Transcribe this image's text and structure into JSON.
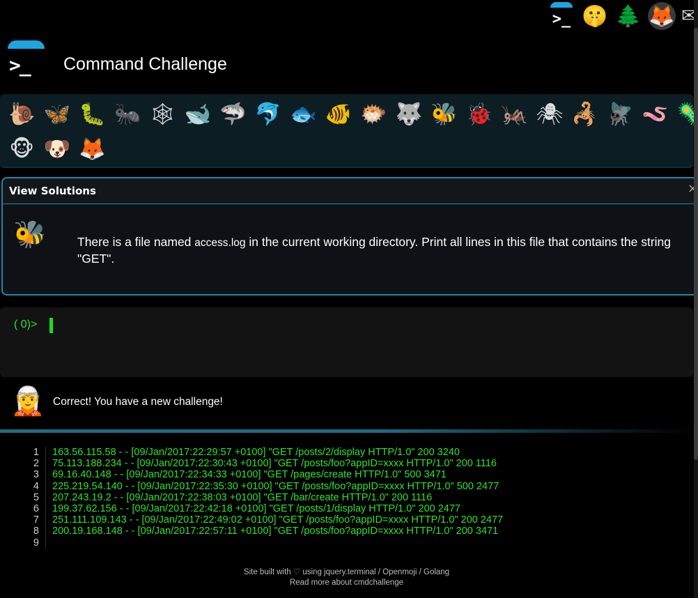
{
  "top_icons": [
    {
      "name": "cmdchallenge-icon",
      "glyph": ">_"
    },
    {
      "name": "shushing-face-icon",
      "glyph": "🤫"
    },
    {
      "name": "tree-icon",
      "glyph": "🌲"
    },
    {
      "name": "gitlab-icon",
      "glyph": "🦊"
    },
    {
      "name": "mail-icon",
      "glyph": "✉"
    }
  ],
  "brand": {
    "prompt_glyph": ">_",
    "title": "Command Challenge"
  },
  "animals": {
    "row1": [
      {
        "name": "snail-icon",
        "glyph": "🐌"
      },
      {
        "name": "butterfly-icon",
        "glyph": "🦋"
      },
      {
        "name": "caterpillar-icon",
        "glyph": "🐛"
      },
      {
        "name": "ant-icon",
        "glyph": "🐜"
      },
      {
        "name": "spider-web-icon",
        "glyph": "🕸"
      },
      {
        "name": "whale-icon",
        "glyph": "🐋"
      },
      {
        "name": "shark-icon",
        "glyph": "🦈"
      },
      {
        "name": "dolphin-icon",
        "glyph": "🐬"
      },
      {
        "name": "fish-icon",
        "glyph": "🐟"
      },
      {
        "name": "tropical-fish-icon",
        "glyph": "🐠"
      },
      {
        "name": "blowfish-icon",
        "glyph": "🐡"
      },
      {
        "name": "wolf-icon",
        "glyph": "🐺"
      },
      {
        "name": "bee-icon",
        "glyph": "🐝"
      },
      {
        "name": "ladybug-icon",
        "glyph": "🐞"
      },
      {
        "name": "cricket-icon",
        "glyph": "🦗"
      },
      {
        "name": "spider-icon",
        "glyph": "🕷"
      },
      {
        "name": "scorpion-icon",
        "glyph": "🦂"
      },
      {
        "name": "fly-icon",
        "glyph": "🪰"
      },
      {
        "name": "worm-icon",
        "glyph": "🪱"
      },
      {
        "name": "microbe-icon",
        "glyph": "🦠"
      }
    ],
    "row2": [
      {
        "name": "monkey-face-icon",
        "glyph": "🐵"
      },
      {
        "name": "dog-face-icon",
        "glyph": "🐶"
      },
      {
        "name": "fox-face-icon",
        "glyph": "🦊"
      }
    ]
  },
  "solutions": {
    "header": "View Solutions",
    "close_glyph": "×",
    "challenge_icon": "🐝",
    "text_before": "There is a file named ",
    "filename": "access.log",
    "text_after": " in the current working directory. Print all lines in this file that contains the string \"GET\"."
  },
  "terminal": {
    "prompt": "( 0)>"
  },
  "feedback": {
    "icon": "🧝",
    "message": "Correct! You have a new challenge!"
  },
  "output": [
    {
      "n": "1",
      "text": "163.56.115.58 - - [09/Jan/2017:22:29:57 +0100] \"GET /posts/2/display HTTP/1.0\" 200 3240"
    },
    {
      "n": "2",
      "text": "75.113.188.234 - - [09/Jan/2017:22:30:43 +0100] \"GET /posts/foo?appID=xxxx HTTP/1.0\" 200 1116"
    },
    {
      "n": "3",
      "text": "69.16.40.148 - - [09/Jan/2017:22:34:33 +0100] \"GET /pages/create HTTP/1.0\" 500 3471"
    },
    {
      "n": "4",
      "text": "225.219.54.140 - - [09/Jan/2017:22:35:30 +0100] \"GET /posts/foo?appID=xxxx HTTP/1.0\" 500 2477"
    },
    {
      "n": "5",
      "text": "207.243.19.2 - - [09/Jan/2017:22:38:03 +0100] \"GET /bar/create HTTP/1.0\" 200 1116"
    },
    {
      "n": "6",
      "text": "199.37.62.156 - - [09/Jan/2017:22:42:18 +0100] \"GET /posts/1/display HTTP/1.0\" 200 2477"
    },
    {
      "n": "7",
      "text": "251.111.109.143 - - [09/Jan/2017:22:49:02 +0100] \"GET /posts/foo?appID=xxxx HTTP/1.0\" 200 2477"
    },
    {
      "n": "8",
      "text": "200.19.168.148 - - [09/Jan/2017:22:57:11 +0100] \"GET /posts/foo?appID=xxxx HTTP/1.0\" 200 3471"
    },
    {
      "n": "9",
      "text": ""
    }
  ],
  "footer": {
    "line1": "Site built with ♡ using jquery.terminal / Openmoji / Golang",
    "line2": "Read more about cmdchallenge"
  },
  "colors": {
    "accent": "#1ba6e2",
    "terminal_green": "#2ee32e",
    "panel_border": "#2088ad"
  }
}
